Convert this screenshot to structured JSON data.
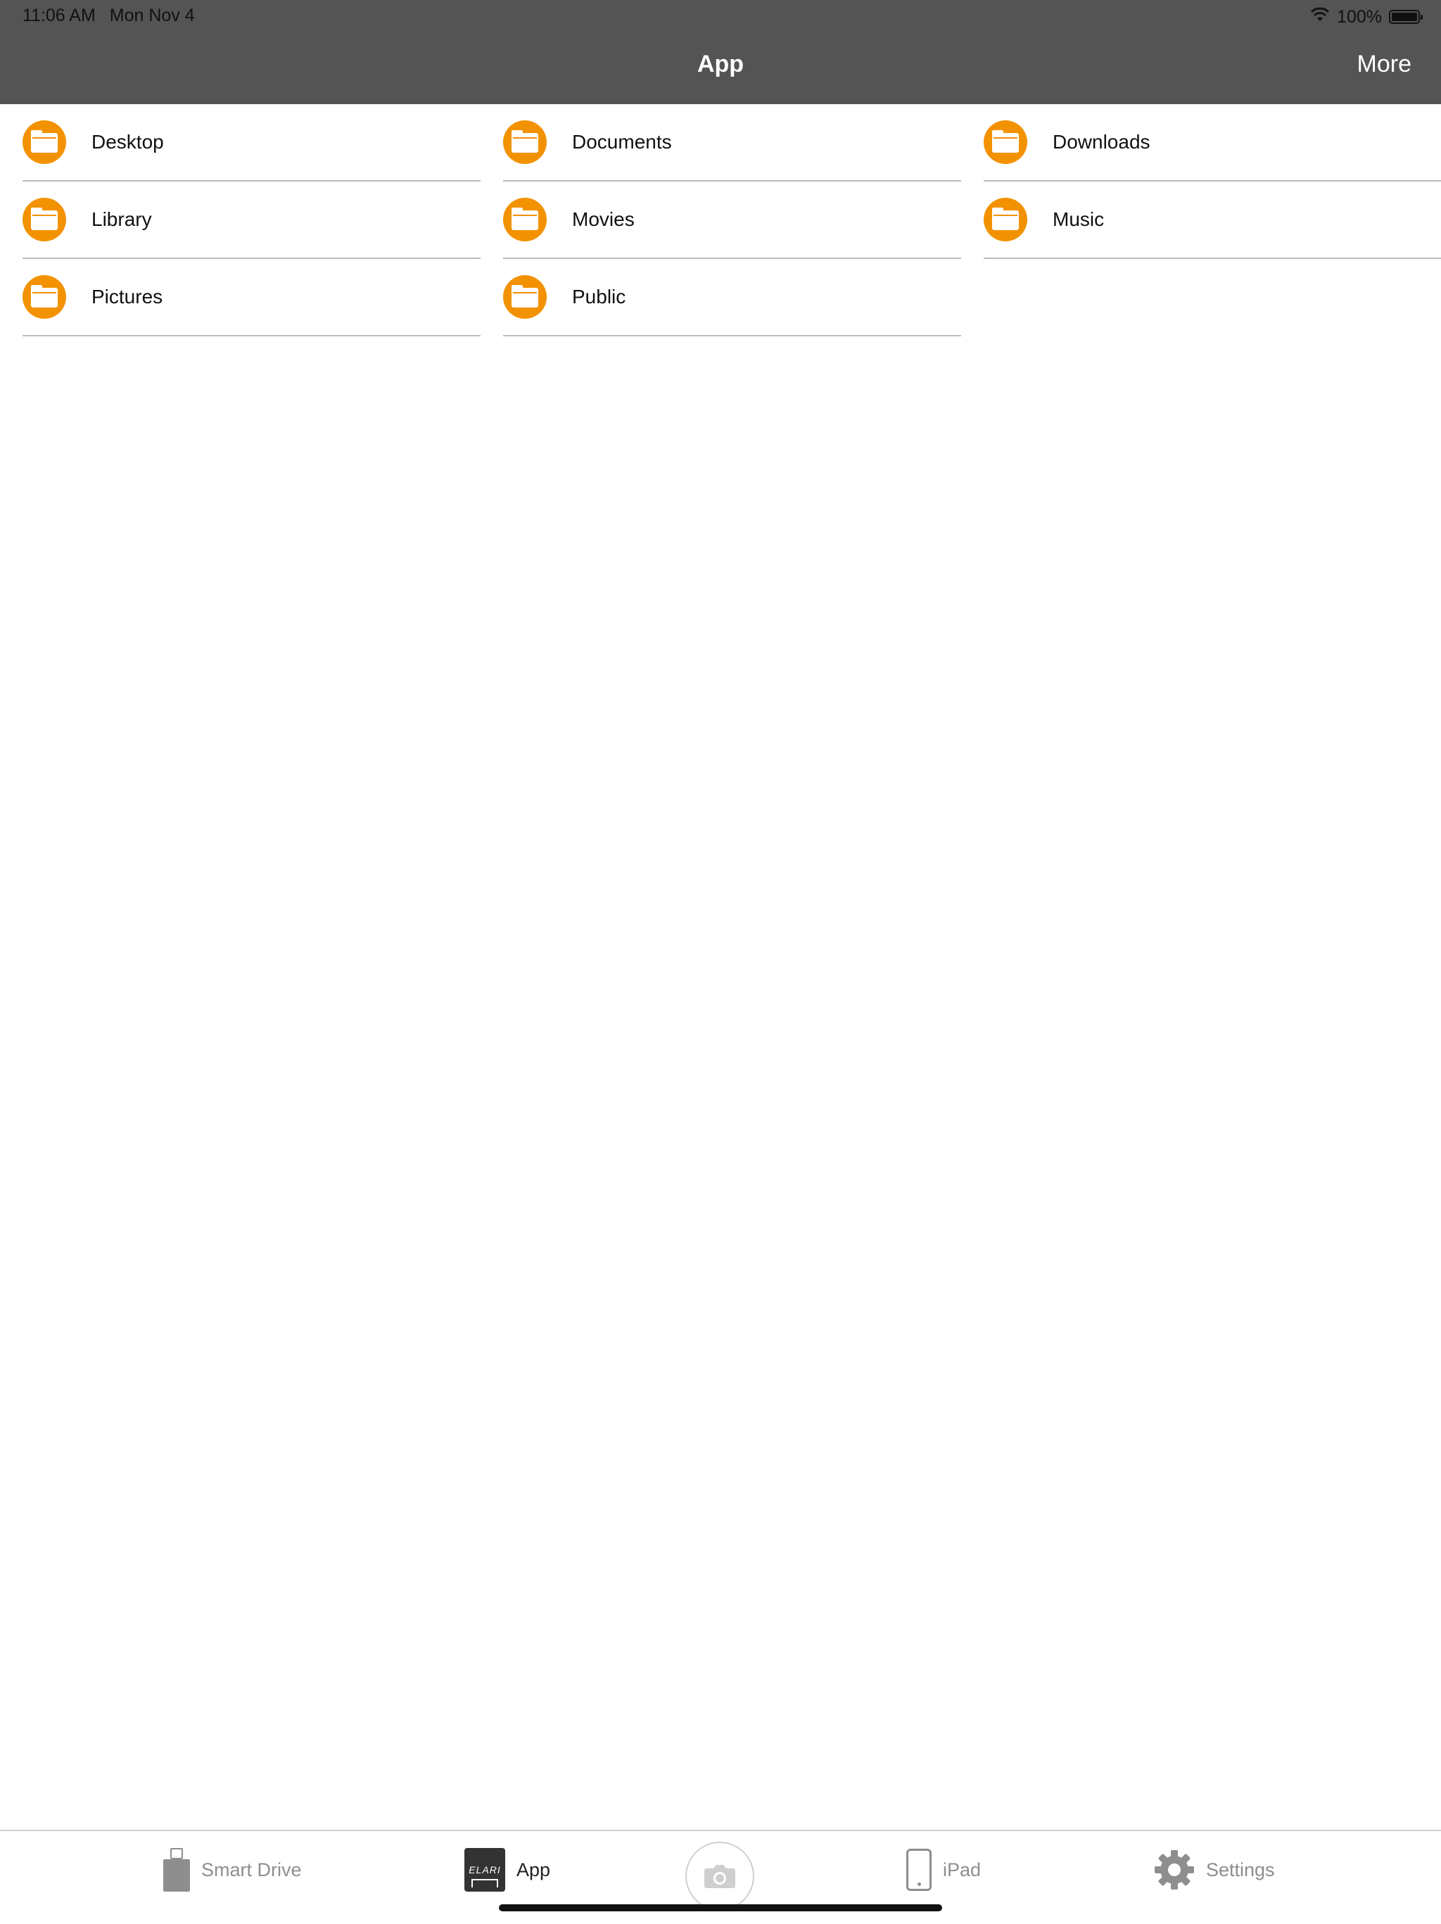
{
  "status_bar": {
    "time": "11:06 AM",
    "date": "Mon Nov 4",
    "battery": "100%",
    "battery_level": 1.0
  },
  "nav": {
    "title": "App",
    "more_label": "More"
  },
  "folders": [
    {
      "label": "Desktop",
      "icon": "folder-icon"
    },
    {
      "label": "Documents",
      "icon": "folder-icon"
    },
    {
      "label": "Downloads",
      "icon": "folder-icon"
    },
    {
      "label": "Library",
      "icon": "folder-icon"
    },
    {
      "label": "Movies",
      "icon": "folder-icon"
    },
    {
      "label": "Music",
      "icon": "folder-icon"
    },
    {
      "label": "Pictures",
      "icon": "folder-icon"
    },
    {
      "label": "Public",
      "icon": "folder-icon"
    }
  ],
  "tabs": [
    {
      "label": "Smart Drive",
      "icon": "usb-drive-icon",
      "active": false
    },
    {
      "label": "App",
      "icon": "elari-app-icon",
      "active": true
    },
    {
      "label": "iPad",
      "icon": "ipad-icon",
      "active": false
    },
    {
      "label": "Settings",
      "icon": "gear-icon",
      "active": false
    }
  ],
  "app_icon_text": "ELARI",
  "colors": {
    "nav_background": "#545454",
    "folder_accent": "#f39200",
    "tab_inactive": "#8e8e8e",
    "tab_active": "#222222"
  }
}
